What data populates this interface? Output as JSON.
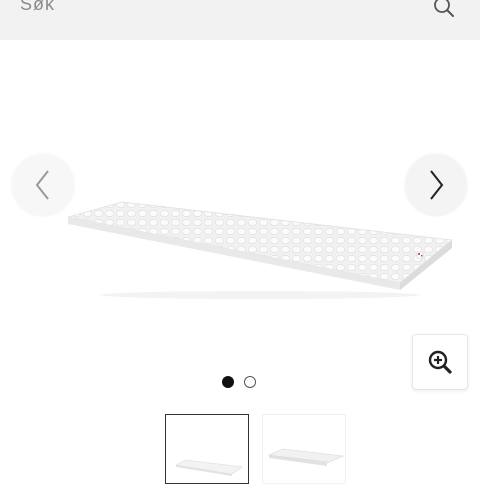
{
  "search": {
    "placeholder": "Søk",
    "icon": "search-icon"
  },
  "gallery": {
    "prev_icon": "chevron-left-icon",
    "next_icon": "chevron-right-icon",
    "zoom_icon": "zoom-in-icon",
    "image_count": 2,
    "active_index": 1
  },
  "colors": {
    "search_bg": "#f2f2f2",
    "dot_active": "#111111",
    "thumb_active_border": "#333333"
  }
}
